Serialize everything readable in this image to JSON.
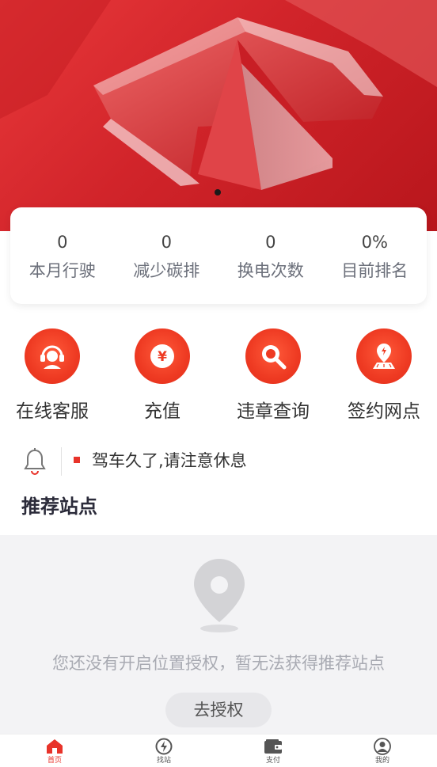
{
  "banner": {
    "indicator_count": 1,
    "active_index": 0
  },
  "stats": [
    {
      "value": "0",
      "label": "本月行驶"
    },
    {
      "value": "0",
      "label": "减少碳排"
    },
    {
      "value": "0",
      "label": "换电次数"
    },
    {
      "value": "0%",
      "label": "目前排名"
    }
  ],
  "services": [
    {
      "label": "在线客服",
      "icon": "customer-service-icon"
    },
    {
      "label": "充值",
      "icon": "yen-coin-icon"
    },
    {
      "label": "违章查询",
      "icon": "search-icon"
    },
    {
      "label": "签约网点",
      "icon": "map-pin-icon"
    }
  ],
  "notice": {
    "icon": "bell-icon",
    "text": "驾车久了,请注意休息"
  },
  "recommend": {
    "title": "推荐站点",
    "empty_text": "您还没有开启位置授权，暂无法获得推荐站点",
    "button_label": "去授权"
  },
  "tabbar": [
    {
      "label": "首页",
      "icon": "home-icon",
      "active": true
    },
    {
      "label": "找站",
      "icon": "lightning-station-icon",
      "active": false
    },
    {
      "label": "支付",
      "icon": "wallet-icon",
      "active": false
    },
    {
      "label": "我的",
      "icon": "user-icon",
      "active": false
    }
  ],
  "colors": {
    "accent": "#e8332a",
    "text": "#333333",
    "muted": "#a8aab2",
    "background_gray": "#f3f3f5"
  }
}
